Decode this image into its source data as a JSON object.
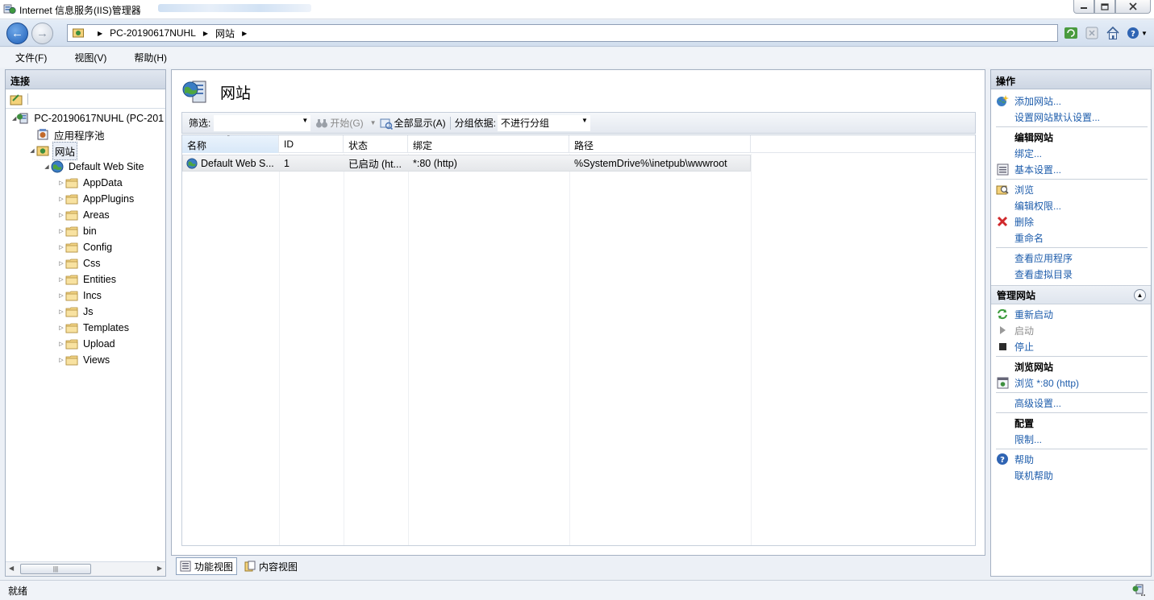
{
  "window": {
    "title": "Internet 信息服务(IIS)管理器",
    "blurred_subtitle": ""
  },
  "address": {
    "crumbs": [
      "PC-20190617NUHL",
      "网站"
    ]
  },
  "menu": {
    "items": [
      "文件(F)",
      "视图(V)",
      "帮助(H)"
    ]
  },
  "connections": {
    "header": "连接",
    "server_label": "PC-20190617NUHL (PC-201",
    "app_pools_label": "应用程序池",
    "sites_label": "网站",
    "default_site_label": "Default Web Site",
    "folders": [
      "AppData",
      "AppPlugins",
      "Areas",
      "bin",
      "Config",
      "Css",
      "Entities",
      "Incs",
      "Js",
      "Templates",
      "Upload",
      "Views"
    ]
  },
  "main": {
    "title": "网站",
    "filter": {
      "label": "筛选:",
      "value": "",
      "go_label": "开始(G)",
      "show_all_label": "全部显示(A)",
      "group_by_label": "分组依据:",
      "group_by_value": "不进行分组"
    },
    "columns": [
      "名称",
      "ID",
      "状态",
      "绑定",
      "路径"
    ],
    "rows": [
      {
        "name": "Default Web S...",
        "id": "1",
        "status": "已启动 (ht...",
        "binding": "*:80 (http)",
        "path": "%SystemDrive%\\inetpub\\wwwroot"
      }
    ],
    "tabs": {
      "features_view": "功能视图",
      "content_view": "内容视图"
    }
  },
  "actions": {
    "header": "操作",
    "add_site": "添加网站...",
    "set_defaults": "设置网站默认设置...",
    "edit_site_section": "编辑网站",
    "bindings": "绑定...",
    "basic_settings": "基本设置...",
    "explore": "浏览",
    "edit_permissions": "编辑权限...",
    "remove": "删除",
    "rename": "重命名",
    "view_applications": "查看应用程序",
    "view_virtual_dirs": "查看虚拟目录",
    "manage_site_section": "管理网站",
    "restart": "重新启动",
    "start": "启动",
    "stop": "停止",
    "browse_site_section": "浏览网站",
    "browse_http": "浏览 *:80 (http)",
    "advanced_settings": "高级设置...",
    "configure_section": "配置",
    "limits": "限制...",
    "help": "帮助",
    "online_help": "联机帮助"
  },
  "status": {
    "text": "就绪"
  },
  "colors": {
    "link": "#1d5cab",
    "panel_border": "#a5b1c2"
  }
}
